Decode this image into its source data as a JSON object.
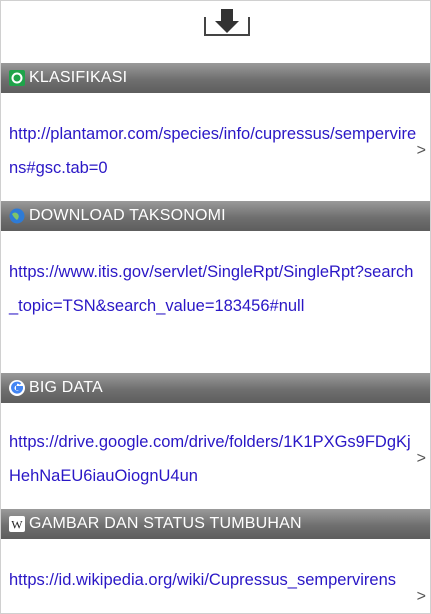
{
  "sections": [
    {
      "icon": "classification-icon",
      "title": "KLASIFIKASI",
      "link": "http://plantamor.com/species/info/cupressus/sempervirens#gsc.tab=0"
    },
    {
      "icon": "globe-icon",
      "title": "DOWNLOAD TAKSONOMI",
      "link": "https://www.itis.gov/servlet/SingleRpt/SingleRpt?search_topic=TSN&search_value=183456#null"
    },
    {
      "icon": "google-icon",
      "title": "BIG DATA",
      "link": "https://drive.google.com/drive/folders/1K1PXGs9FDgKjHehNaEU6iauOiognU4un"
    },
    {
      "icon": "wikipedia-icon",
      "title": "GAMBAR DAN STATUS TUMBUHAN",
      "link": "https://id.wikipedia.org/wiki/Cupressus_sempervirens"
    }
  ],
  "icons": {
    "download": "download-icon",
    "chevron": "chevron-right-icon"
  },
  "colors": {
    "link": "#2a17c6",
    "header": "#6f6f6f",
    "header_text": "#ffffff"
  }
}
